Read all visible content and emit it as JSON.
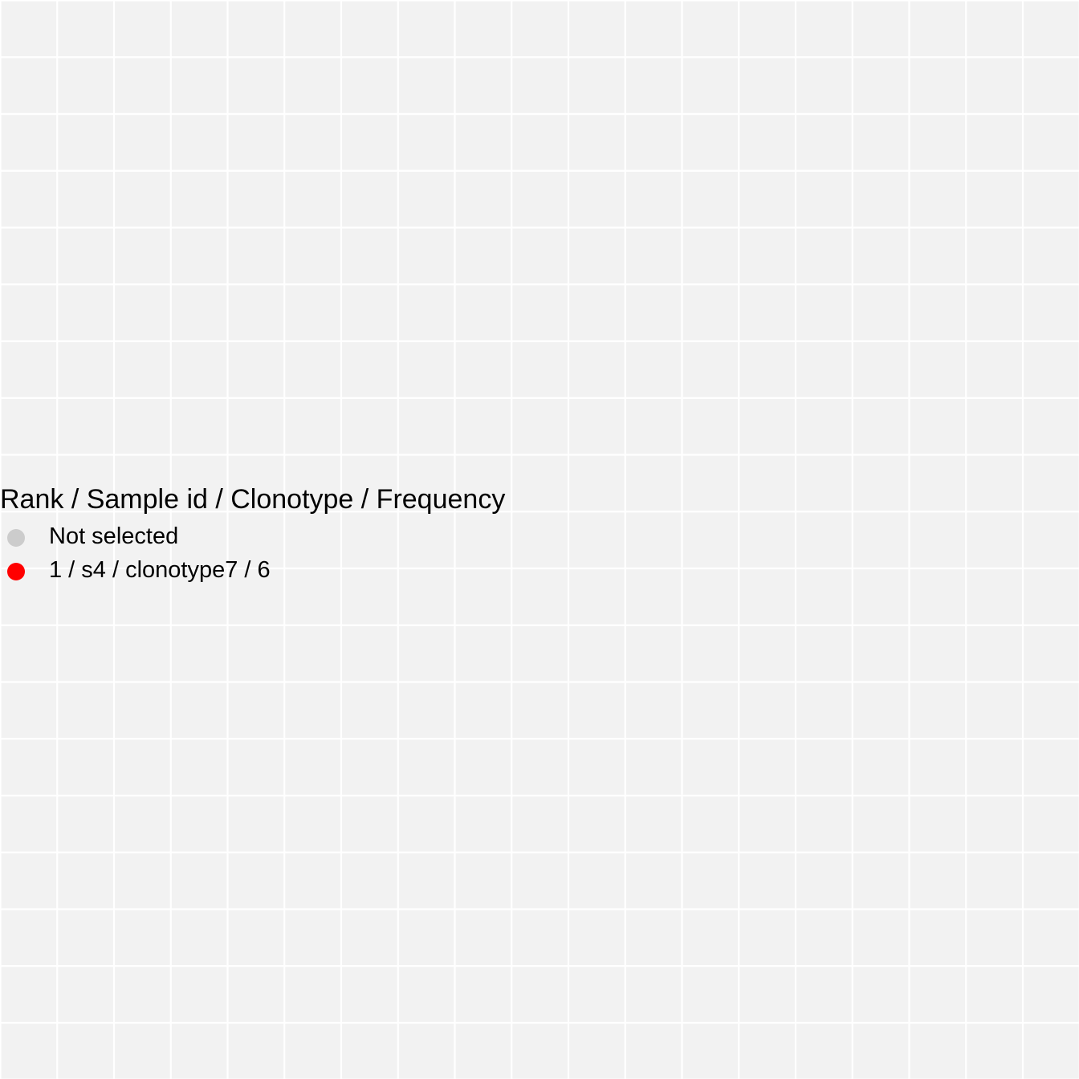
{
  "chart_data": {
    "type": "scatter",
    "title": "",
    "xlabel": "",
    "ylabel": "",
    "grid": true,
    "axes_visible": false,
    "background_color": "#f2f2f2",
    "grid_color": "#ffffff",
    "x": [],
    "y": [],
    "legend": {
      "title": "Rank / Sample id / Clonotype / Frequency",
      "placement": "left",
      "entries": [
        {
          "label": "Not selected",
          "color": "#cccccc"
        },
        {
          "label": "1 / s4 / clonotype7 / 6",
          "color": "#ff0000"
        }
      ]
    }
  }
}
